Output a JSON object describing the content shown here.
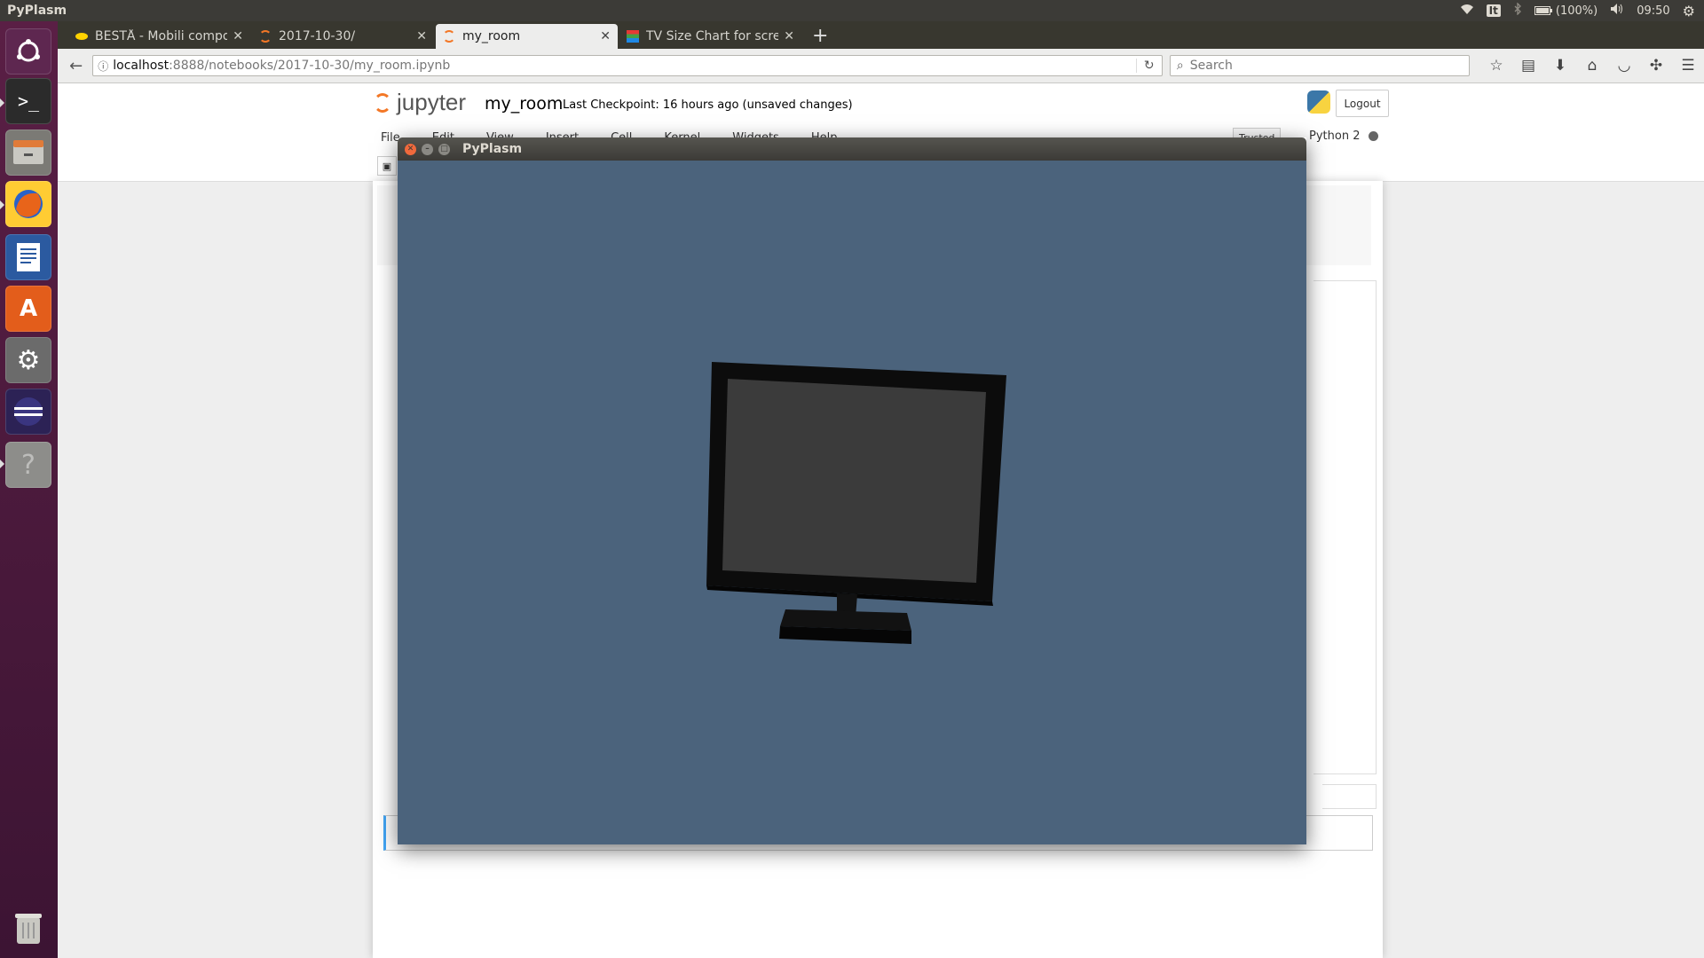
{
  "top_panel": {
    "app_name": "PyPlasm",
    "keyboard": "It",
    "battery": "(100%)",
    "clock": "09:50"
  },
  "launcher": {
    "items": [
      "ubuntu-dash",
      "terminal",
      "files",
      "firefox",
      "libreoffice-writer",
      "software-center",
      "system-settings",
      "eclipse",
      "unknown-app",
      "trash"
    ]
  },
  "browser": {
    "tabs": [
      {
        "label": "BESTÅ - Mobili compon",
        "active": false
      },
      {
        "label": "2017-10-30/",
        "active": false
      },
      {
        "label": "my_room",
        "active": true
      },
      {
        "label": "TV Size Chart for scree",
        "active": false
      }
    ],
    "url_host": "localhost",
    "url_rest": ":8888/notebooks/2017-10-30/my_room.ipynb",
    "search_placeholder": "Search"
  },
  "jupyter": {
    "logo_text": "jupyter",
    "notebook_name": "my_room",
    "checkpoint": "Last Checkpoint: 16 hours ago (unsaved changes)",
    "logout": "Logout",
    "menu": [
      "File",
      "Edit",
      "View",
      "Insert",
      "Cell",
      "Kernel",
      "Widgets",
      "Help"
    ],
    "trusted": "Trusted",
    "kernel": "Python 2"
  },
  "pyplasm_window": {
    "title": "PyPlasm",
    "background_color": "#4b637c",
    "scene": "tv-monitor-3d-model"
  }
}
